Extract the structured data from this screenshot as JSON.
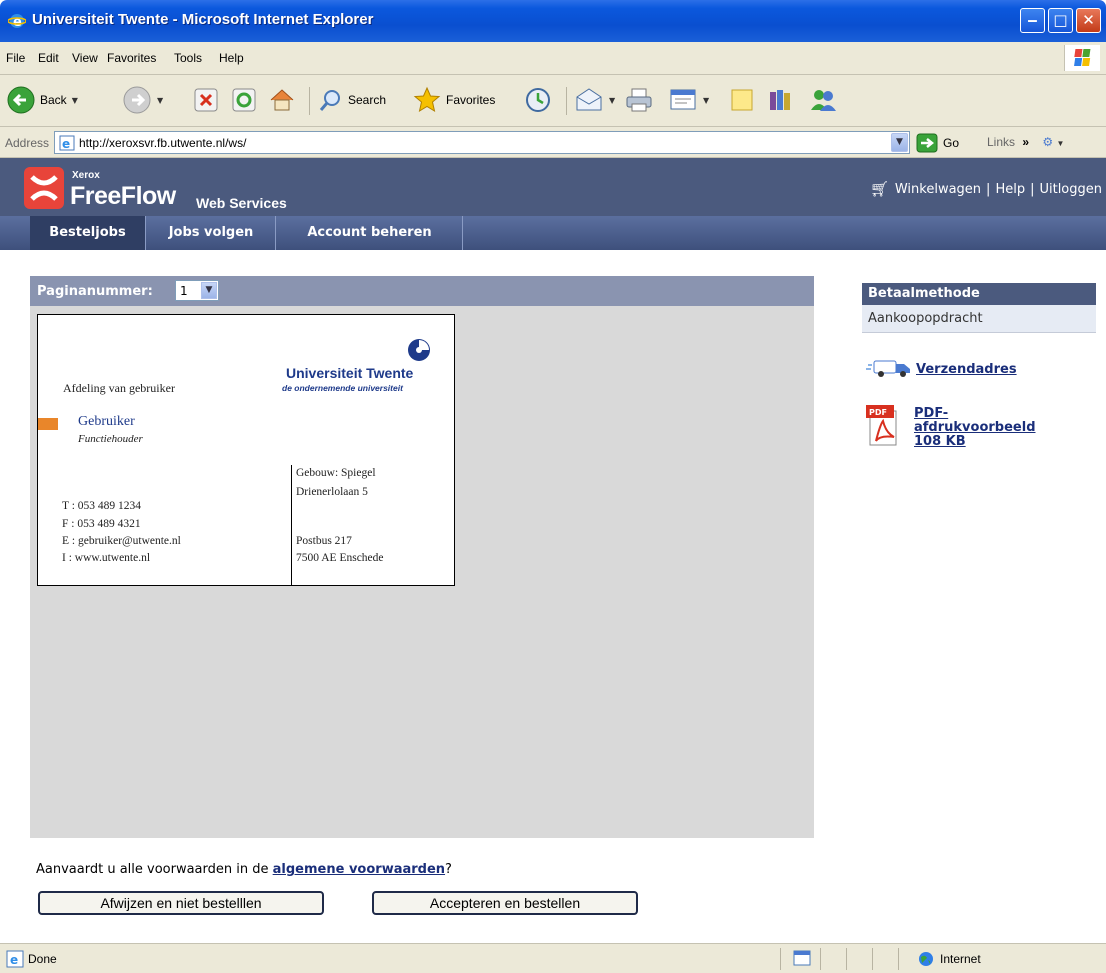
{
  "window": {
    "title": "Universiteit Twente - Microsoft Internet Explorer",
    "controls": [
      "minimize",
      "maximize",
      "close"
    ]
  },
  "menu": [
    "File",
    "Edit",
    "View",
    "Favorites",
    "Tools",
    "Help"
  ],
  "toolbar": {
    "back": "Back",
    "search": "Search",
    "favorites": "Favorites"
  },
  "address": {
    "label": "Address",
    "url": "http://xeroxsvr.fb.utwente.nl/ws/",
    "go": "Go",
    "links": "Links"
  },
  "header": {
    "brand_small": "Xerox",
    "brand": "FreeFlow",
    "brand_sub": "Web Services",
    "cart": "Winkelwagen",
    "help": "Help",
    "logout": "Uitloggen",
    "separator": "|"
  },
  "tabs": [
    "Besteljobs",
    "Jobs volgen",
    "Account beheren"
  ],
  "panel": {
    "page_label": "Paginanummer:",
    "page_value": "1"
  },
  "card": {
    "org": "Universiteit Twente",
    "tagline": "de ondernemende universiteit",
    "department": "Afdeling van gebruiker",
    "name": "Gebruiker",
    "function": "Functiehouder",
    "contact": [
      "T : 053 489 1234",
      "F : 053 489 4321",
      "E : gebruiker@utwente.nl",
      "I : www.utwente.nl"
    ],
    "address_top": [
      "Gebouw: Spiegel",
      "Drienerlolaan 5"
    ],
    "address_bottom": [
      "Postbus 217",
      "7500 AE Enschede"
    ]
  },
  "sidebar": {
    "payment_head": "Betaalmethode",
    "payment_value": "Aankoopopdracht",
    "shipping_link": "Verzendadres",
    "pdf_badge": "PDF",
    "pdf_link_1": "PDF-",
    "pdf_link_2": "afdrukvoorbeeld",
    "pdf_size": "108 KB"
  },
  "terms": {
    "text_before": "Aanvaardt u alle voorwaarden in de ",
    "link": "algemene voorwaarden",
    "text_after": "?"
  },
  "buttons": {
    "reject": "Afwijzen en niet bestelllen",
    "accept": "Accepteren en bestellen"
  },
  "status": {
    "text": "Done",
    "zone": "Internet"
  },
  "colors": {
    "header": "#4b5a7e",
    "panel": "#d9d9d9",
    "link": "#1a2e7a",
    "accent_orange": "#e9862a"
  }
}
